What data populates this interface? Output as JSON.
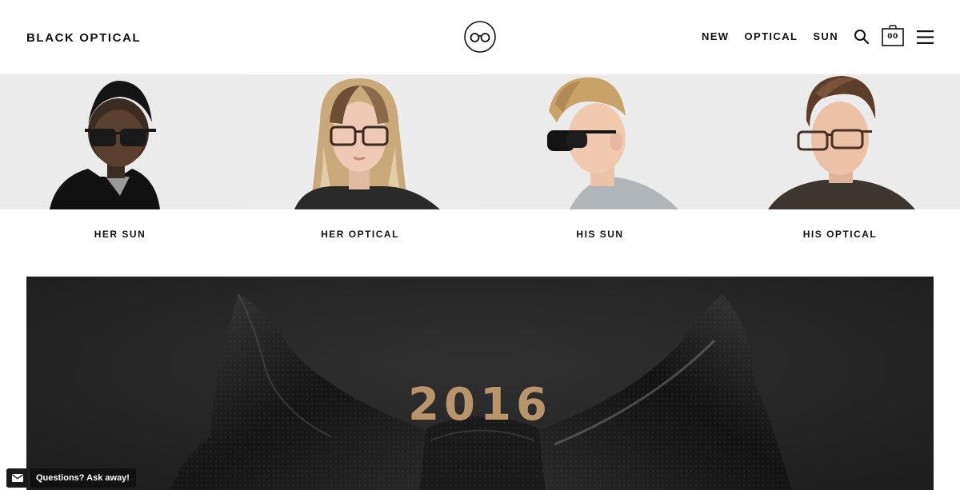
{
  "header": {
    "brand": "BLACK OPTICAL",
    "nav": [
      "NEW",
      "OPTICAL",
      "SUN"
    ],
    "cart_count": "00"
  },
  "categories": [
    {
      "label": "HER SUN"
    },
    {
      "label": "HER OPTICAL"
    },
    {
      "label": "HIS SUN"
    },
    {
      "label": "HIS OPTICAL"
    }
  ],
  "hero": {
    "year": "2016"
  },
  "chat": {
    "text": "Questions? Ask away!"
  },
  "colors": {
    "accent_gold": "#b8956a",
    "hero_background": "#2a2a2a",
    "panel_background": "#ececec"
  }
}
